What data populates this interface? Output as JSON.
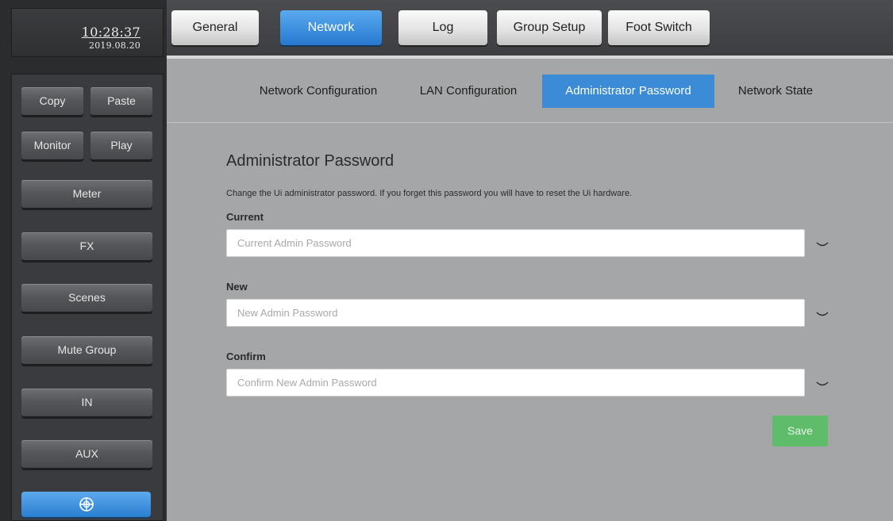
{
  "clock": {
    "time": "10:28:37",
    "date": "2019.08.20"
  },
  "sidebar": {
    "copy": "Copy",
    "paste": "Paste",
    "monitor": "Monitor",
    "play": "Play",
    "meter": "Meter",
    "fx": "FX",
    "scenes": "Scenes",
    "mute_group": "Mute Group",
    "in": "IN",
    "aux": "AUX",
    "bottom_icon": "crosshair-circle-icon"
  },
  "tabs": {
    "general": "General",
    "network": "Network",
    "log": "Log",
    "group_setup": "Group Setup",
    "foot_switch": "Foot Switch",
    "active": "Network"
  },
  "subtabs": {
    "network_configuration": "Network Configuration",
    "lan_configuration": "LAN Configuration",
    "administrator_password": "Administrator Password",
    "network_state": "Network State",
    "active": "Administrator Password"
  },
  "form": {
    "title": "Administrator Password",
    "description": "Change the Ui administrator password. If you forget this password you will have to reset the Ui hardware.",
    "current_label": "Current",
    "current_placeholder": "Current Admin Password",
    "current_value": "",
    "new_label": "New",
    "new_placeholder": "New Admin Password",
    "new_value": "",
    "confirm_label": "Confirm",
    "confirm_placeholder": "Confirm New Admin Password",
    "confirm_value": "",
    "save_label": "Save",
    "reveal_icon": "eye-closed-icon"
  },
  "colors": {
    "accent_blue": "#3b8bd6",
    "save_green": "#5fbc6a",
    "content_bg": "#a5a6a8",
    "sidebar_bg": "#3a3b3e"
  }
}
